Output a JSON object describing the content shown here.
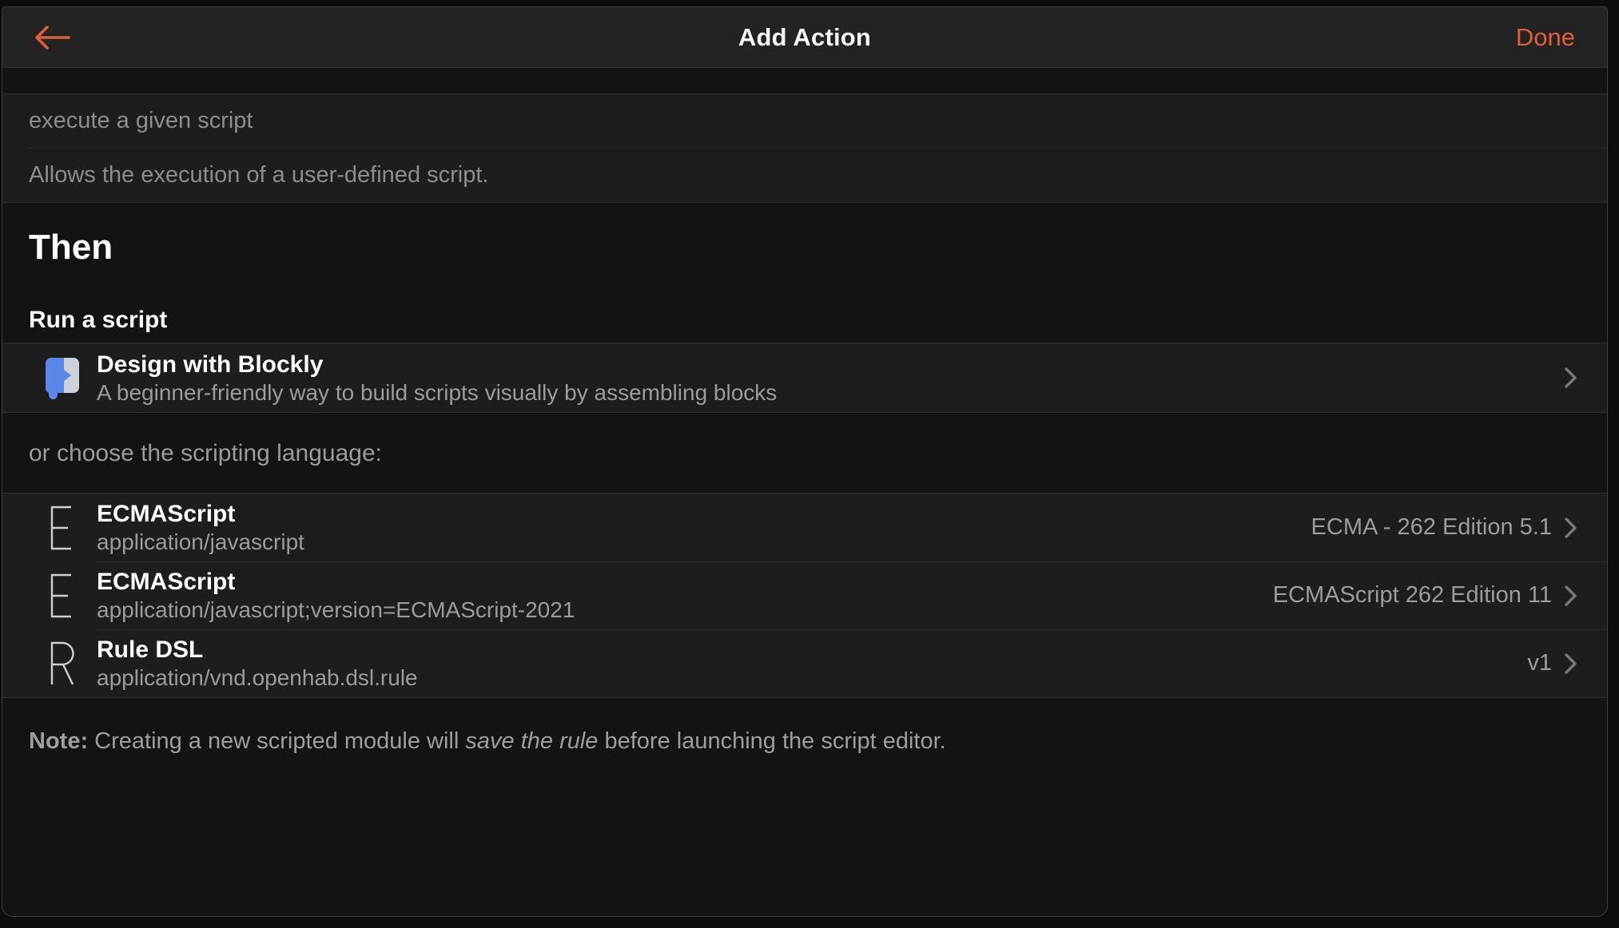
{
  "navbar": {
    "title": "Add Action",
    "done_label": "Done"
  },
  "search": {
    "query": "execute a given script",
    "description": "Allows the execution of a user-defined script."
  },
  "section": {
    "title": "Then",
    "subtitle": "Run a script"
  },
  "blockly": {
    "title": "Design with Blockly",
    "subtitle": "A beginner-friendly way to build scripts visually by assembling blocks"
  },
  "choose_label": "or choose the scripting language:",
  "languages": [
    {
      "icon_letter": "E",
      "title": "ECMAScript",
      "subtitle": "application/javascript",
      "version": "ECMA - 262 Edition 5.1"
    },
    {
      "icon_letter": "E",
      "title": "ECMAScript",
      "subtitle": "application/javascript;version=ECMAScript-2021",
      "version": "ECMAScript 262 Edition 11"
    },
    {
      "icon_letter": "R",
      "title": "Rule DSL",
      "subtitle": "application/vnd.openhab.dsl.rule",
      "version": "v1"
    }
  ],
  "note": {
    "label": "Note:",
    "text_before_italic": " Creating a new scripted module will ",
    "italic": "save the rule",
    "text_after_italic": " before launching the script editor."
  },
  "colors": {
    "accent": "#de5f3b",
    "blockly-blue": "#5b87e8",
    "blockly-gray": "#ccd1da",
    "chevron": "#787878"
  }
}
